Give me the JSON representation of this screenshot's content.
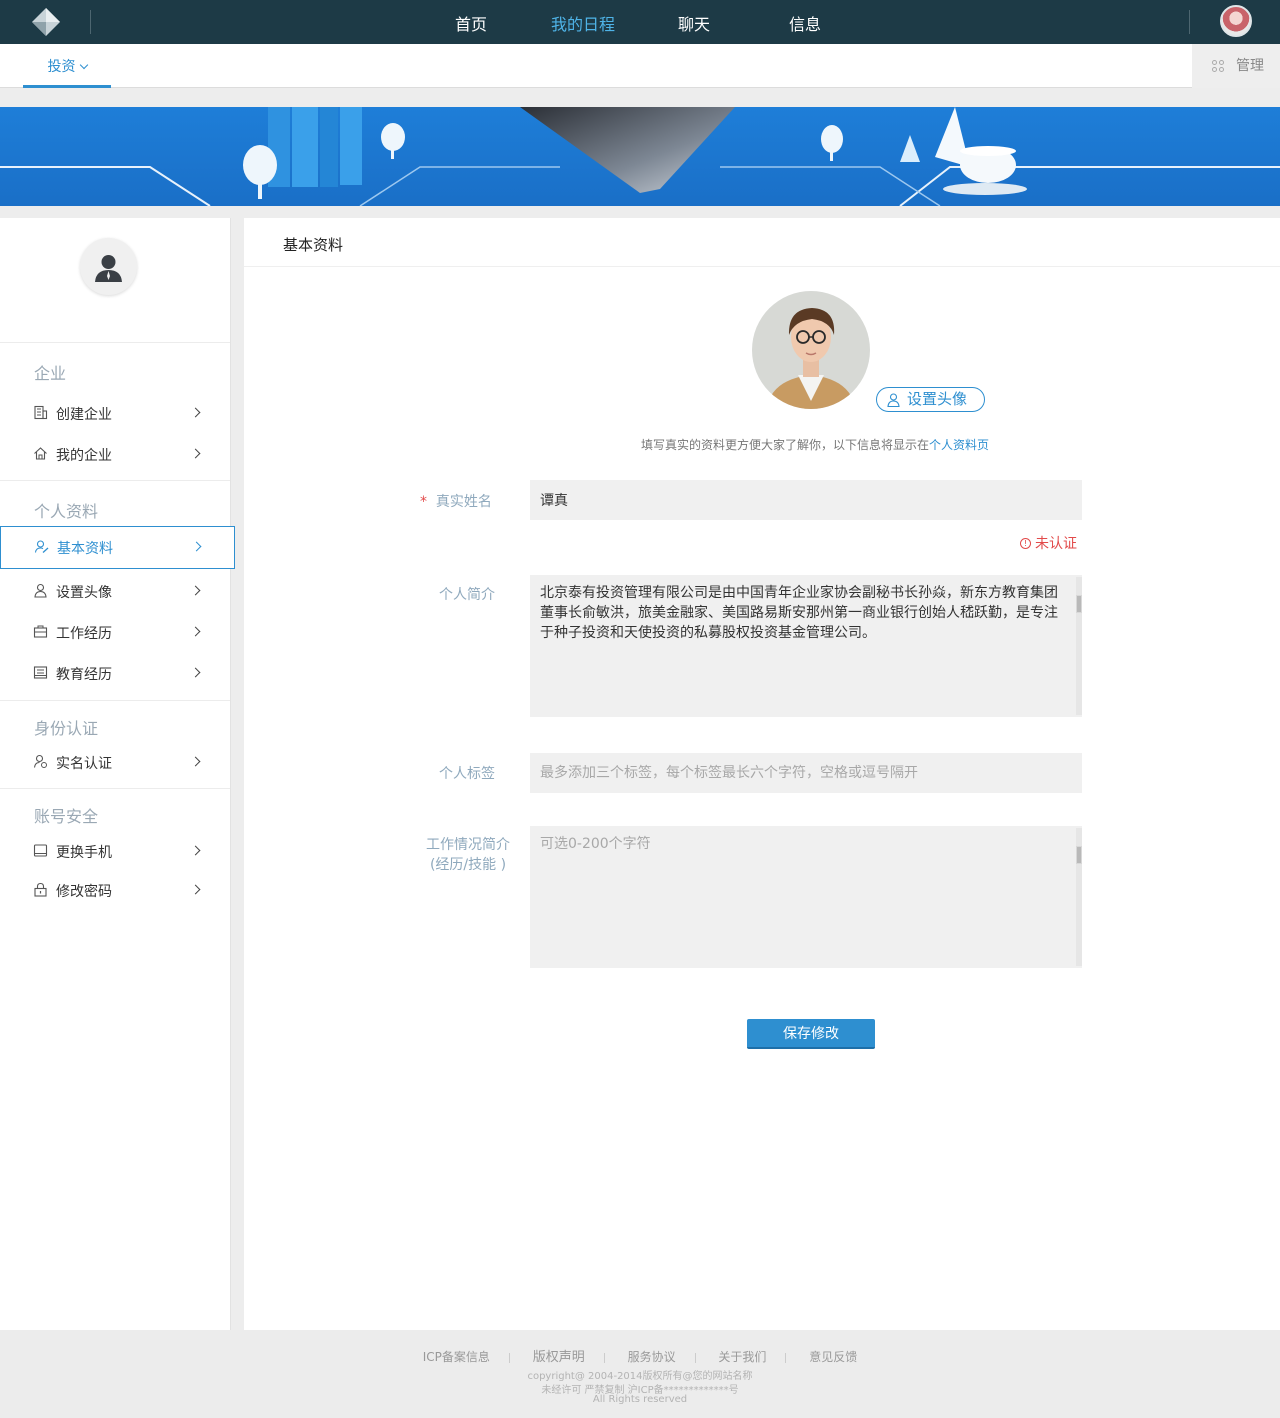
{
  "topnav": {
    "items": [
      {
        "label": "首页",
        "active": false
      },
      {
        "label": "我的日程",
        "active": true
      },
      {
        "label": "聊天",
        "active": false
      },
      {
        "label": "信息",
        "active": false
      }
    ]
  },
  "subnav": {
    "tab_label": "投资",
    "manage_label": "管理"
  },
  "sidebar": {
    "sections": [
      {
        "title": "企业",
        "items": [
          {
            "label": "创建企业",
            "icon": "building-icon"
          },
          {
            "label": "我的企业",
            "icon": "home-icon"
          }
        ]
      },
      {
        "title": "个人资料",
        "items": [
          {
            "label": "基本资料",
            "icon": "user-edit-icon",
            "active": true
          },
          {
            "label": "设置头像",
            "icon": "user-icon"
          },
          {
            "label": "工作经历",
            "icon": "briefcase-icon"
          },
          {
            "label": "教育经历",
            "icon": "book-icon"
          }
        ]
      },
      {
        "title": "身份认证",
        "items": [
          {
            "label": "实名认证",
            "icon": "user-verify-icon"
          }
        ]
      },
      {
        "title": "账号安全",
        "items": [
          {
            "label": "更换手机",
            "icon": "phone-icon"
          },
          {
            "label": "修改密码",
            "icon": "lock-icon"
          }
        ]
      }
    ]
  },
  "main": {
    "title": "基本资料",
    "set_avatar_label": "设置头像",
    "hint_text": "填写真实的资料更方便大家了解你，以下信息将显示在",
    "hint_link": "个人资料页",
    "form": {
      "name_required_mark": "*",
      "name_label": "真实姓名",
      "name_value": "谭真",
      "unverified_label": "未认证",
      "bio_label": "个人简介",
      "bio_value": "北京泰有投资管理有限公司是由中国青年企业家协会副秘书长孙焱，新东方教育集团董事长俞敏洪，旅美金融家、美国路易斯安那州第一商业银行创始人嵇跃勤，是专注于种子投资和天使投资的私募股权投资基金管理公司。",
      "tags_label": "个人标签",
      "tags_placeholder": "最多添加三个标签，每个标签最长六个字符，空格或逗号隔开",
      "work_label_line1": "工作情况简介",
      "work_label_line2": "(经历/技能 )",
      "work_placeholder": "可选0-200个字符"
    },
    "save_label": "保存修改"
  },
  "footer": {
    "links": [
      "ICP备案信息",
      "版权声明",
      "服务协议",
      "关于我们",
      "意见反馈"
    ],
    "copyright": "copyright@ 2004-2014版权所有@您的网站名称",
    "license": "未经许可 严禁复制 沪ICP备*************号",
    "rights": "All Rights reserved"
  },
  "colors": {
    "topnav_bg": "#1d3a46",
    "accent": "#2e8fd0",
    "error": "#e24a4a",
    "label": "#8fa9bd"
  }
}
